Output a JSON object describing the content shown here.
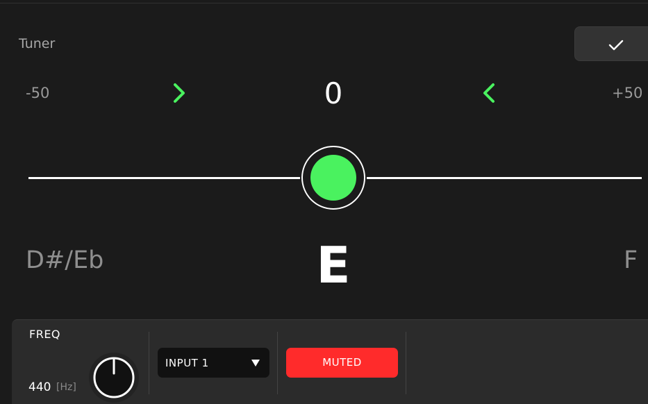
{
  "tuner": {
    "title": "Tuner",
    "range_min": "-50",
    "range_max": "+50",
    "cents": "0",
    "cents_value": 0,
    "note_prev": "D#/Eb",
    "note_current": "E",
    "note_next": "F",
    "in_tune_color": "#4af25f"
  },
  "toolbar": {
    "confirm_icon": "check-icon"
  },
  "panel": {
    "freq_label": "FREQ",
    "freq_value": "440",
    "freq_unit": "[Hz]",
    "input_select": {
      "selected": "INPUT 1",
      "icon": "caret-down-icon"
    },
    "mute_button": {
      "label": "MUTED",
      "color": "#ff2b2b"
    }
  }
}
